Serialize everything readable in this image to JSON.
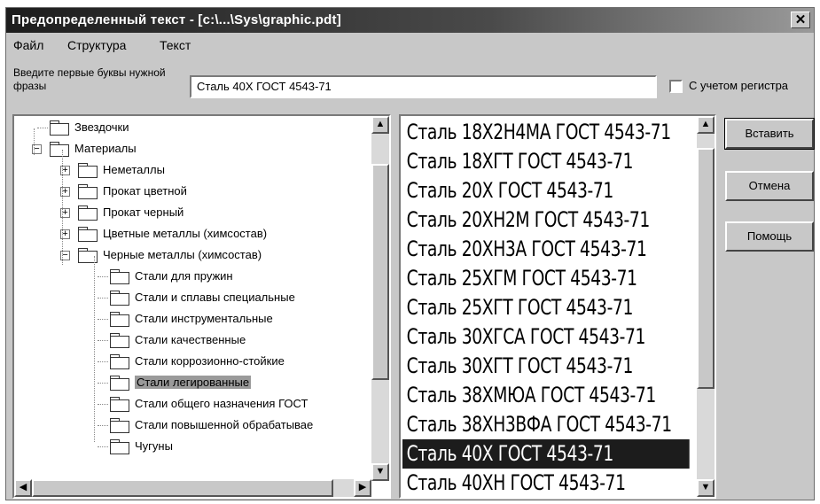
{
  "window": {
    "title": "Предопределенный текст - [c:\\...\\Sys\\graphic.pdt]",
    "close_glyph": "✕"
  },
  "menu": [
    {
      "label": "Файл"
    },
    {
      "label": "Структура"
    },
    {
      "label": "Текст"
    }
  ],
  "search": {
    "prompt": "Введите первые буквы нужной фразы",
    "value": "Сталь 40Х ГОСТ 4543-71",
    "case_label": "С учетом регистра",
    "case_checked": false
  },
  "tree": {
    "items": [
      {
        "label": "Звездочки",
        "expander": ""
      },
      {
        "label": "Материалы",
        "expander": "−"
      },
      {
        "label": "Неметаллы",
        "expander": "+"
      },
      {
        "label": "Прокат цветной",
        "expander": "+"
      },
      {
        "label": "Прокат черный",
        "expander": "+"
      },
      {
        "label": "Цветные металлы (химсостав)",
        "expander": "+"
      },
      {
        "label": "Черные металлы (химсостав)",
        "expander": "−"
      },
      {
        "label": "Стали для пружин",
        "expander": ""
      },
      {
        "label": "Стали и сплавы специальные",
        "expander": ""
      },
      {
        "label": "Стали инструментальные",
        "expander": ""
      },
      {
        "label": "Стали качественные",
        "expander": ""
      },
      {
        "label": "Стали коррозионно-стойкие",
        "expander": ""
      },
      {
        "label": "Стали легированные",
        "expander": ""
      },
      {
        "label": "Стали общего назначения ГОСТ",
        "expander": ""
      },
      {
        "label": "Стали повышенной обрабатывае",
        "expander": ""
      },
      {
        "label": "Чугуны",
        "expander": ""
      }
    ]
  },
  "list": {
    "items": [
      "Сталь 18Х2Н4МА ГОСТ 4543-71",
      "Сталь 18ХГТ ГОСТ 4543-71",
      "Сталь 20Х ГОСТ 4543-71",
      "Сталь 20ХН2М ГОСТ 4543-71",
      "Сталь 20ХН3А ГОСТ 4543-71",
      "Сталь 25ХГМ ГОСТ 4543-71",
      "Сталь 25ХГТ ГОСТ 4543-71",
      "Сталь 30ХГСА ГОСТ 4543-71",
      "Сталь 30ХГТ ГОСТ 4543-71",
      "Сталь 38ХМЮА ГОСТ 4543-71",
      "Сталь 38ХН3ВФА ГОСТ 4543-71",
      "Сталь 40Х ГОСТ 4543-71",
      "Сталь 40ХН ГОСТ 4543-71"
    ],
    "selected_index": 11
  },
  "buttons": {
    "insert": "Вставить",
    "cancel": "Отмена",
    "help": "Помощь"
  },
  "colors": {
    "selection_list": "#1c1c1c",
    "selection_tree": "#9a9a9a",
    "face": "#c8c8c8"
  }
}
